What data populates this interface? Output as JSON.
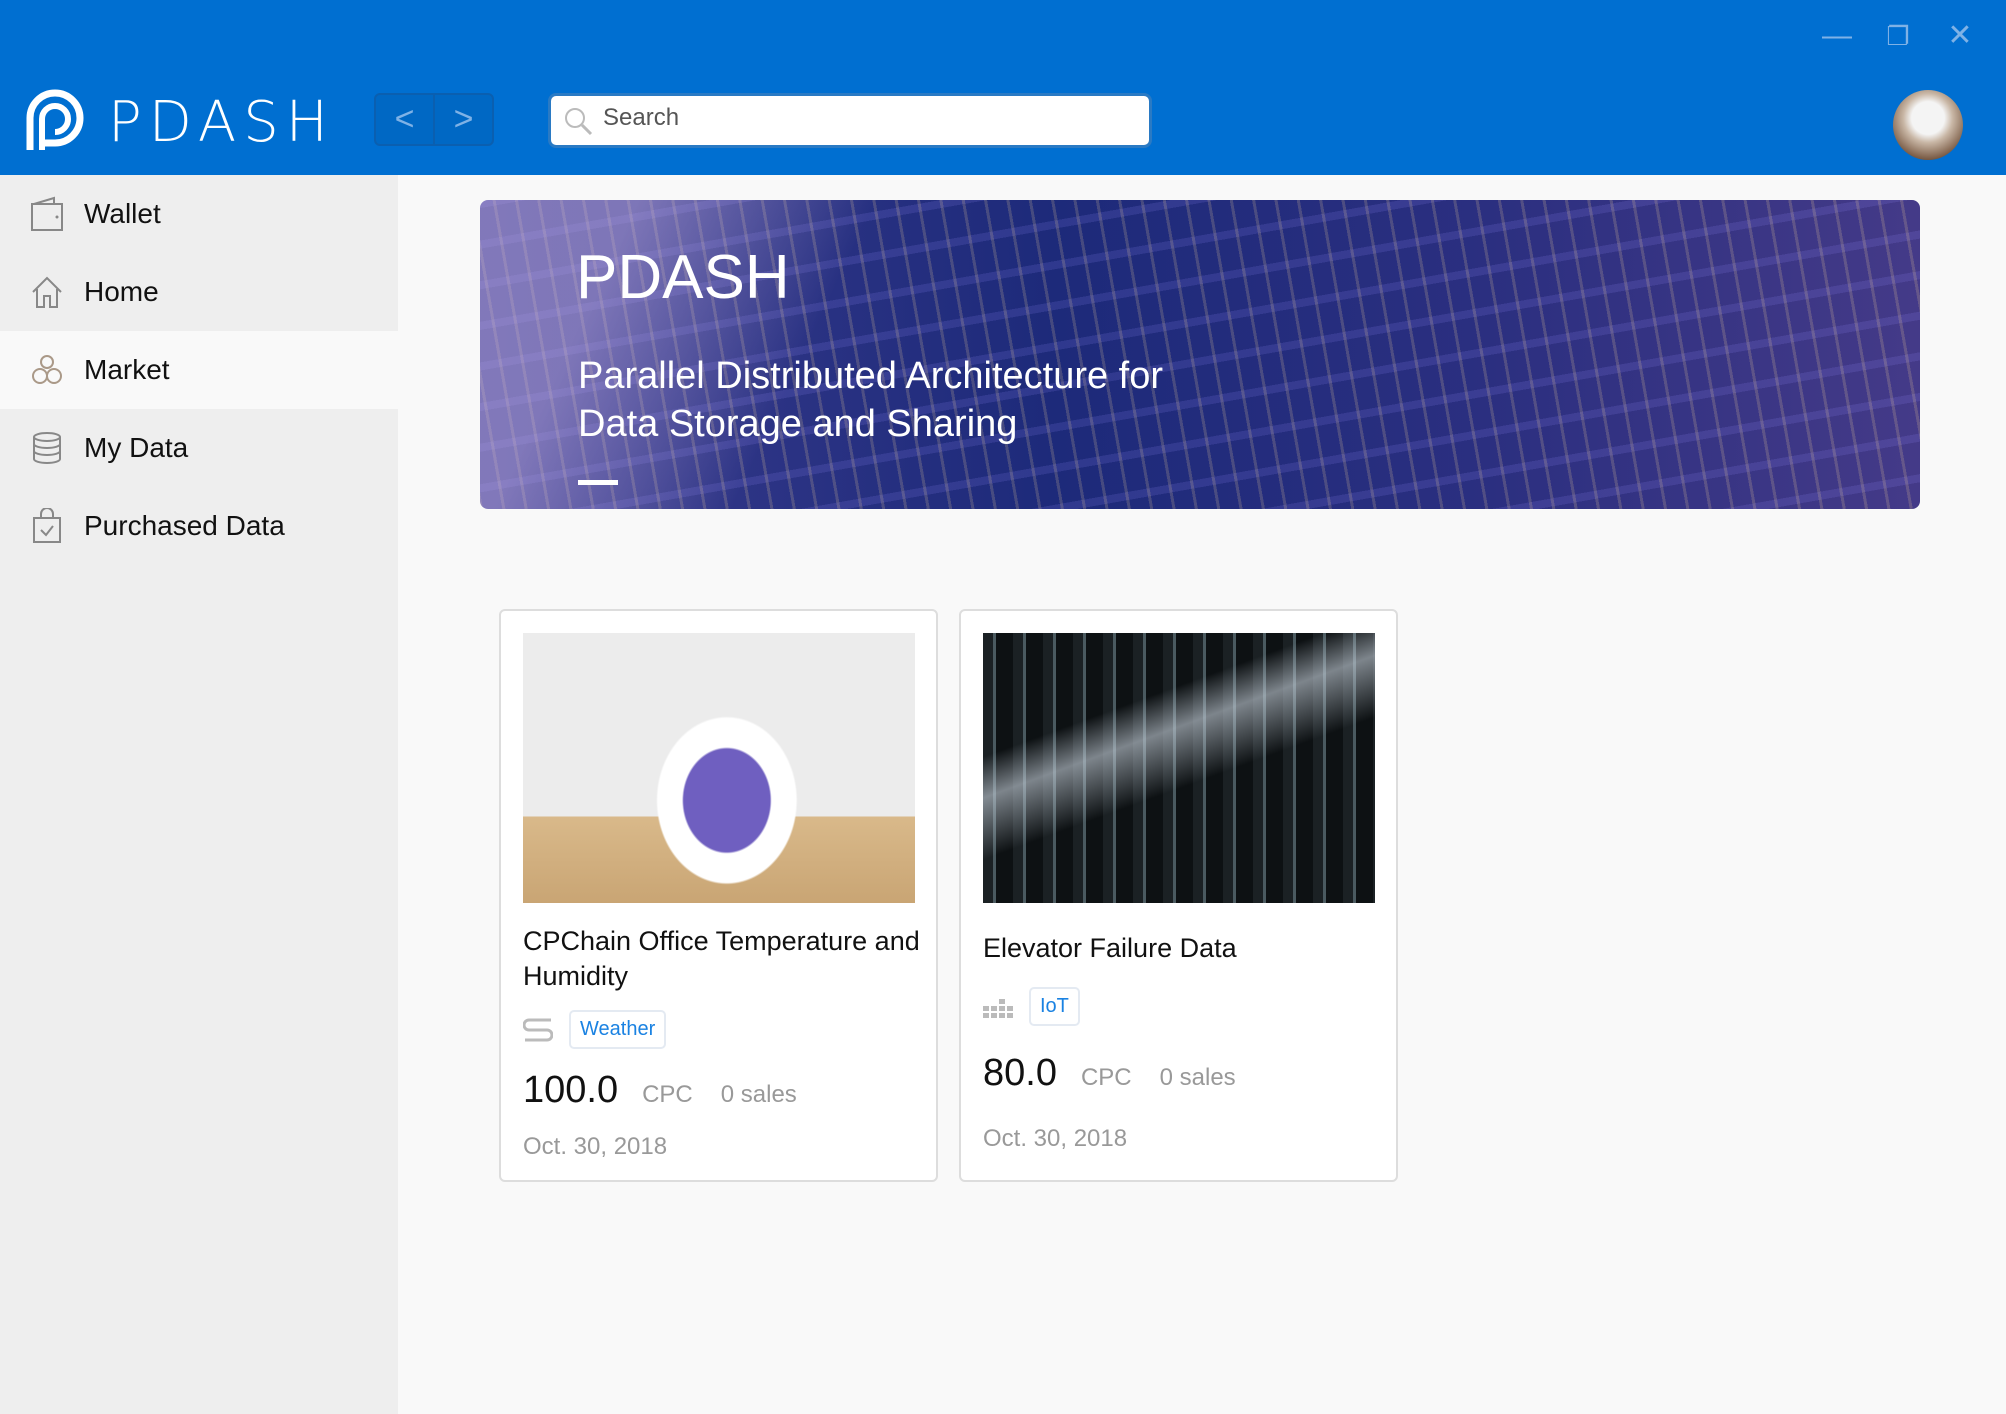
{
  "window": {
    "minimize": "—",
    "restore": "❐",
    "close": "✕"
  },
  "header": {
    "brand": "PDASH",
    "back": "<",
    "forward": ">",
    "search_placeholder": "Search"
  },
  "sidebar": {
    "items": [
      {
        "label": "Wallet",
        "icon": "wallet-icon"
      },
      {
        "label": "Home",
        "icon": "home-icon"
      },
      {
        "label": "Market",
        "icon": "market-icon",
        "active": true
      },
      {
        "label": "My Data",
        "icon": "database-icon"
      },
      {
        "label": "Purchased Data",
        "icon": "purchased-icon"
      }
    ]
  },
  "banner": {
    "title": "PDASH",
    "subtitle_line1": "Parallel Distributed Architecture for",
    "subtitle_line2": "Data Storage and Sharing"
  },
  "products": [
    {
      "title": "CPChain Office Temperature and Humidity",
      "tag": "Weather",
      "price": "100.0",
      "unit": "CPC",
      "sales": "0 sales",
      "date": "Oct. 30, 2018"
    },
    {
      "title": "Elevator Failure Data",
      "tag": "IoT",
      "price": "80.0",
      "unit": "CPC",
      "sales": "0 sales",
      "date": "Oct. 30, 2018"
    }
  ],
  "colors": {
    "header": "#006fd1",
    "sidebar": "#eeeeee",
    "tag": "#1a82e2"
  }
}
